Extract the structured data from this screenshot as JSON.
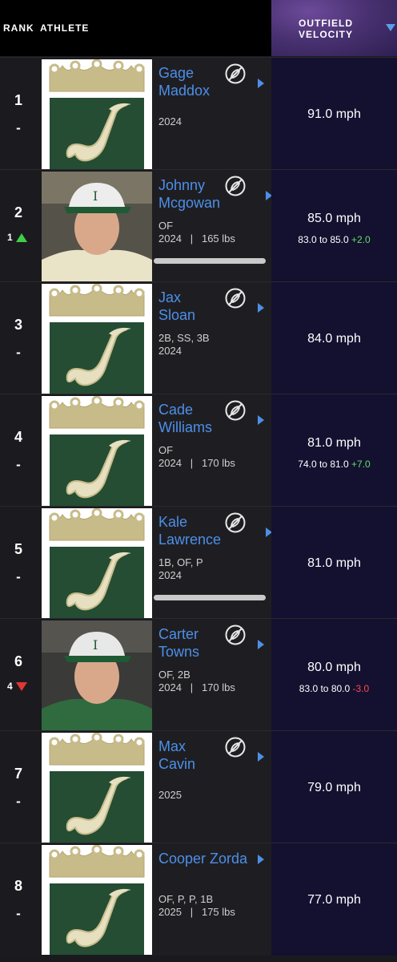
{
  "header": {
    "rank_label": "RANK",
    "athlete_label": "ATHLETE",
    "velocity_label": "OUTFIELD\nVELOCITY"
  },
  "colors": {
    "link": "#4d8fe8",
    "up": "#3ecf4a",
    "down": "#e23535",
    "header_accent": "#4a3272"
  },
  "rows": [
    {
      "rank": "1",
      "change": "-",
      "name": "Gage\nMaddox",
      "meta1": "",
      "meta2": "2024",
      "velocity": "91.0 mph",
      "photo": "logo-icon"
    },
    {
      "rank": "2",
      "move": "1",
      "direction": "up",
      "name": "Johnny\nMcgowan",
      "meta1": "OF",
      "meta2": "2024   |   165 lbs",
      "velocity": "85.0 mph",
      "range": "83.0 to 85.0",
      "delta": "+2.0",
      "photo": "player-photo"
    },
    {
      "rank": "3",
      "change": "-",
      "name": "Jax\nSloan",
      "meta1": "2B, SS, 3B",
      "meta2": "2024",
      "velocity": "84.0 mph",
      "photo": "logo-icon"
    },
    {
      "rank": "4",
      "change": "-",
      "name": "Cade\nWilliams",
      "meta1": "OF",
      "meta2": "2024   |   170 lbs",
      "velocity": "81.0 mph",
      "range": "74.0 to 81.0",
      "delta": "+7.0",
      "photo": "logo-icon"
    },
    {
      "rank": "5",
      "change": "-",
      "name": "Kale\nLawrence",
      "meta1": "1B, OF, P",
      "meta2": "2024",
      "velocity": "81.0 mph",
      "photo": "logo-icon"
    },
    {
      "rank": "6",
      "move": "4",
      "direction": "down",
      "name": "Carter\nTowns",
      "meta1": "OF, 2B",
      "meta2": "2024   |   170 lbs",
      "velocity": "80.0 mph",
      "range": "83.0 to 80.0",
      "delta": "-3.0",
      "photo": "player-photo"
    },
    {
      "rank": "7",
      "change": "-",
      "name": "Max\nCavin",
      "meta1": "",
      "meta2": "2025",
      "velocity": "79.0 mph",
      "photo": "logo-icon"
    },
    {
      "rank": "8",
      "change": "-",
      "name": "Cooper Zorda",
      "meta1": "OF, P, P, 1B",
      "meta2": "2025   |   175 lbs",
      "velocity": "77.0 mph",
      "photo": "logo-icon"
    }
  ]
}
